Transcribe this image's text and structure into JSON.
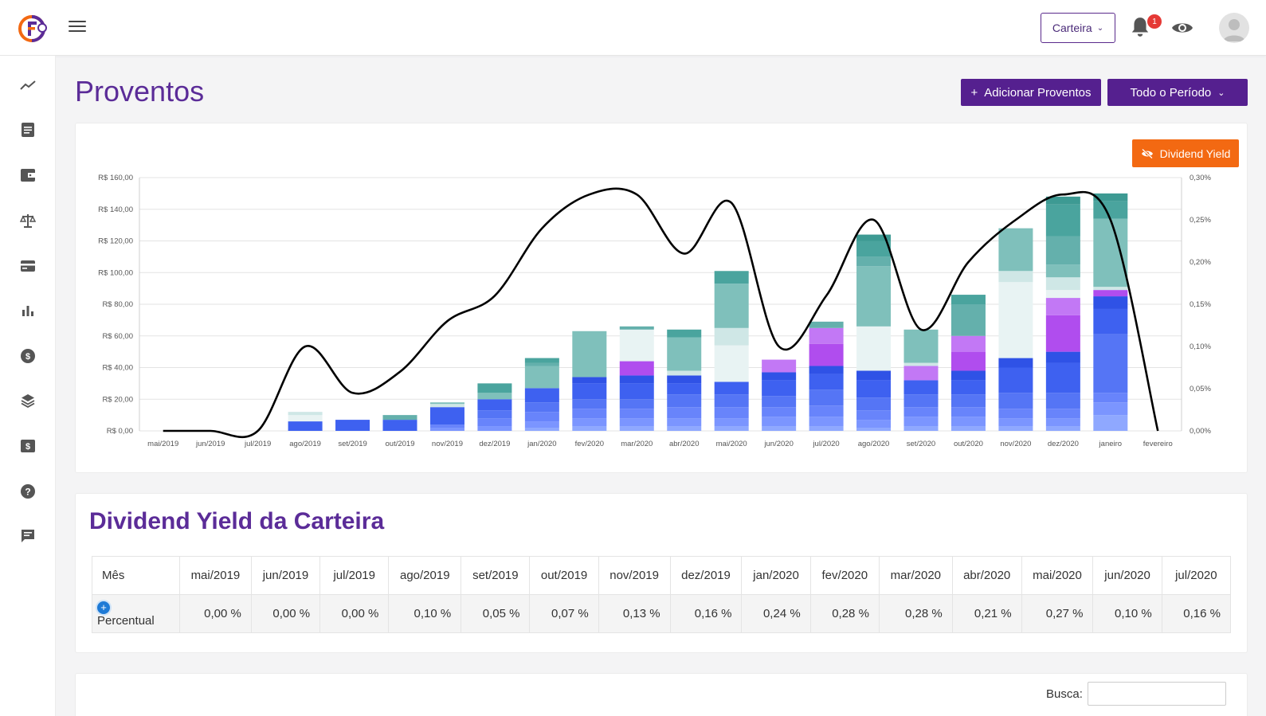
{
  "header": {
    "wallet_label": "Carteira",
    "notification_count": "1"
  },
  "page": {
    "title": "Proventos",
    "add_button": "Adicionar Proventos",
    "period_button": "Todo o Período",
    "dy_toggle": "Dividend Yield"
  },
  "chart_data": {
    "type": "bar",
    "stacked": true,
    "categories": [
      "mai/2019",
      "jun/2019",
      "jul/2019",
      "ago/2019",
      "set/2019",
      "out/2019",
      "nov/2019",
      "dez/2019",
      "jan/2020",
      "fev/2020",
      "mar/2020",
      "abr/2020",
      "mai/2020",
      "jun/2020",
      "jul/2020",
      "ago/2020",
      "set/2020",
      "out/2020",
      "nov/2020",
      "dez/2020",
      "janeiro",
      "fevereiro"
    ],
    "y_ticks": [
      "R$ 0,00",
      "R$ 20,00",
      "R$ 40,00",
      "R$ 60,00",
      "R$ 80,00",
      "R$ 100,00",
      "R$ 120,00",
      "R$ 140,00",
      "R$ 160,00"
    ],
    "y2_ticks": [
      "0,00%",
      "0,05%",
      "0,10%",
      "0,15%",
      "0,20%",
      "0,25%",
      "0,30%"
    ],
    "ylim": [
      0,
      160
    ],
    "y2lim": [
      0,
      0.3
    ],
    "grid": true,
    "series": [
      {
        "color": "#8fa8ff",
        "values": [
          0,
          0,
          0,
          0,
          0,
          0,
          0,
          0,
          2,
          3,
          3,
          3,
          3,
          3,
          3,
          2,
          3,
          3,
          3,
          3,
          10,
          0
        ]
      },
      {
        "color": "#7b95ff",
        "values": [
          0,
          0,
          0,
          0,
          0,
          0,
          2,
          3,
          4,
          5,
          5,
          5,
          5,
          6,
          6,
          5,
          6,
          6,
          5,
          5,
          8,
          0
        ]
      },
      {
        "color": "#6884fb",
        "values": [
          0,
          0,
          0,
          0,
          0,
          0,
          2,
          5,
          6,
          6,
          6,
          7,
          7,
          6,
          7,
          6,
          6,
          6,
          6,
          6,
          6,
          0
        ]
      },
      {
        "color": "#5575f5",
        "values": [
          0,
          0,
          0,
          0,
          0,
          0,
          0,
          5,
          6,
          6,
          6,
          8,
          8,
          7,
          10,
          8,
          8,
          8,
          10,
          10,
          37,
          0
        ]
      },
      {
        "color": "#3e61f0",
        "values": [
          0,
          0,
          0,
          6,
          7,
          7,
          11,
          7,
          9,
          10,
          10,
          7,
          8,
          10,
          10,
          11,
          9,
          9,
          16,
          19,
          16,
          0
        ]
      },
      {
        "color": "#2f52e6",
        "values": [
          0,
          0,
          0,
          0,
          0,
          0,
          0,
          0,
          0,
          4,
          5,
          5,
          0,
          5,
          5,
          6,
          0,
          6,
          6,
          7,
          8,
          0
        ]
      },
      {
        "color": "#b04dee",
        "values": [
          0,
          0,
          0,
          0,
          0,
          0,
          0,
          0,
          0,
          0,
          9,
          0,
          0,
          0,
          14,
          0,
          0,
          12,
          0,
          23,
          4,
          0
        ]
      },
      {
        "color": "#c278f5",
        "values": [
          0,
          0,
          0,
          0,
          0,
          0,
          0,
          0,
          0,
          0,
          0,
          0,
          0,
          8,
          10,
          0,
          9,
          10,
          0,
          11,
          0,
          0
        ]
      },
      {
        "color": "#e8f3f3",
        "values": [
          0,
          0,
          0,
          4,
          0,
          0,
          0,
          0,
          0,
          0,
          20,
          0,
          23,
          0,
          0,
          28,
          0,
          0,
          48,
          5,
          0,
          0
        ]
      },
      {
        "color": "#cfe7e6",
        "values": [
          0,
          0,
          0,
          2,
          0,
          0,
          2,
          0,
          0,
          0,
          0,
          3,
          11,
          0,
          0,
          0,
          2,
          0,
          7,
          8,
          2,
          0
        ]
      },
      {
        "color": "#7fc0bb",
        "values": [
          0,
          0,
          0,
          0,
          0,
          0,
          1,
          4,
          14,
          29,
          0,
          21,
          28,
          0,
          0,
          38,
          21,
          0,
          27,
          8,
          43,
          0
        ]
      },
      {
        "color": "#64b0ac",
        "values": [
          0,
          0,
          0,
          0,
          0,
          3,
          0,
          0,
          2,
          0,
          2,
          0,
          0,
          0,
          4,
          6,
          0,
          20,
          0,
          18,
          0,
          0
        ]
      },
      {
        "color": "#4aa49e",
        "values": [
          0,
          0,
          0,
          0,
          0,
          0,
          0,
          6,
          3,
          0,
          0,
          5,
          8,
          0,
          0,
          10,
          0,
          6,
          0,
          20,
          11,
          0
        ]
      },
      {
        "color": "#3d9a93",
        "values": [
          0,
          0,
          0,
          0,
          0,
          0,
          0,
          0,
          0,
          0,
          0,
          0,
          0,
          0,
          0,
          4,
          0,
          0,
          0,
          5,
          5,
          0
        ]
      }
    ],
    "dividend_yield": [
      0.0,
      0.0,
      0.0,
      0.1,
      0.045,
      0.07,
      0.13,
      0.16,
      0.24,
      0.28,
      0.28,
      0.21,
      0.27,
      0.1,
      0.16,
      0.25,
      0.12,
      0.2,
      0.25,
      0.28,
      0.25,
      0.0
    ]
  },
  "dy_table": {
    "title": "Dividend Yield da Carteira",
    "header_first": "Mês",
    "row_label": "Percentual",
    "months": [
      "mai/2019",
      "jun/2019",
      "jul/2019",
      "ago/2019",
      "set/2019",
      "out/2019",
      "nov/2019",
      "dez/2019",
      "jan/2020",
      "fev/2020",
      "mar/2020",
      "abr/2020",
      "mai/2020",
      "jun/2020",
      "jul/2020"
    ],
    "values": [
      "0,00 %",
      "0,00 %",
      "0,00 %",
      "0,10 %",
      "0,05 %",
      "0,07 %",
      "0,13 %",
      "0,16 %",
      "0,24 %",
      "0,28 %",
      "0,28 %",
      "0,21 %",
      "0,27 %",
      "0,10 %",
      "0,16 %"
    ]
  },
  "search": {
    "label": "Busca:"
  },
  "colors": {
    "brand_purple": "#55208f",
    "title_purple": "#5b2c98",
    "orange": "#f36912"
  }
}
